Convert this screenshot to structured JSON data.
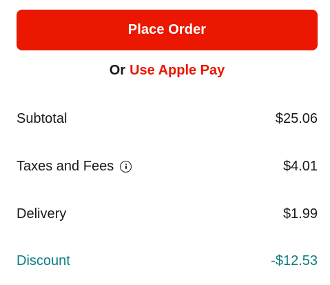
{
  "checkout": {
    "place_order_label": "Place Order",
    "alt_payment_prefix": "Or",
    "alt_payment_link": "Use Apple Pay"
  },
  "summary": {
    "rows": [
      {
        "label": "Subtotal",
        "value": "$25.06"
      },
      {
        "label": "Taxes and Fees",
        "value": "$4.01",
        "icon": "info-icon"
      },
      {
        "label": "Delivery",
        "value": "$1.99"
      },
      {
        "label": "Discount",
        "value": "-$12.53"
      }
    ]
  },
  "colors": {
    "accent": "#eb1700",
    "discount": "#0b7d80",
    "text": "#191919"
  }
}
